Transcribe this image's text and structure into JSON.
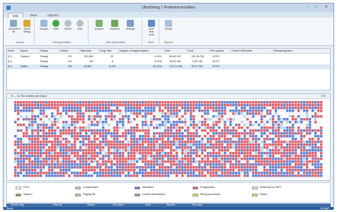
{
  "window": {
    "title": "UltraDefrag 7 Professional Edition",
    "minimize": "–",
    "maximize": "□",
    "close": "✕"
  },
  "ribbon_tabs": [
    {
      "label": "Disk",
      "active": true
    },
    {
      "label": "View",
      "active": false
    },
    {
      "label": "Options",
      "active": false
    }
  ],
  "ribbon_groups": [
    {
      "label": "Actions",
      "buttons": [
        {
          "label": "Autodetect all",
          "icon": "drive-icon",
          "color": "#8aa7c8"
        },
        {
          "label": "Quick defrag",
          "icon": "broom-icon",
          "color": "#d5a935"
        }
      ]
    },
    {
      "label": "Defragmentation",
      "buttons": [
        {
          "label": "Analyze",
          "icon": "magnify-icon",
          "color": "#9bb8d8"
        },
        {
          "label": "Start",
          "icon": "play-icon",
          "color": "#3fa845"
        },
        {
          "label": "Pause",
          "icon": "pause-icon",
          "color": "#b8c0c8"
        },
        {
          "label": "Stop",
          "icon": "stop-icon",
          "color": "#b8c0c8"
        }
      ]
    },
    {
      "label": "Disk Optimization",
      "buttons": [
        {
          "label": "Analyze",
          "icon": "chart-icon",
          "color": "#7bb26a"
        },
        {
          "label": "Optimize",
          "icon": "optimize-icon",
          "color": "#6fa75c"
        },
        {
          "label": "Settings",
          "icon": "settings-icon",
          "color": "#7b9bc8"
        }
      ]
    },
    {
      "label": "Boot",
      "buttons": [
        {
          "label": "Boot time scan",
          "icon": "boot-icon",
          "color": "#5d8cc4"
        }
      ]
    },
    {
      "label": "Reports",
      "buttons": [
        {
          "label": "Create",
          "icon": "report-icon",
          "color": "#a9c0da"
        }
      ]
    }
  ],
  "table": {
    "columns": [
      "Drive",
      "Name",
      "Status",
      "Status",
      "Total files",
      "Frag. files",
      "Degree of fragmentation",
      "Size",
      "Free",
      "File system",
      "Current file/folder",
      "Remaining time"
    ],
    "rows": [
      [
        "(C:)",
        "System",
        "Ready",
        "0%",
        "120,082",
        "20",
        "",
        "11.6%",
        "99.66 GB",
        "125.35 GB",
        "NTFS",
        "",
        ""
      ],
      [
        "(D:)",
        "",
        "Ready",
        "0%",
        "100",
        "0",
        "",
        "0.00%",
        "78.69 GB",
        "0.62 GB",
        "NTFS",
        "",
        ""
      ],
      [
        "(E:)",
        "Daten",
        "Ready",
        "0%",
        "10,567",
        "8,423",
        "",
        "40.32%",
        "173.73 GB",
        "76.47 GB",
        "NTFS",
        "",
        ""
      ]
    ],
    "selected_row": 2
  },
  "map": {
    "title": "E: – 11,784 clusters per block",
    "progress": "0 %"
  },
  "legend": [
    {
      "label": "Free",
      "color": "#ffffff"
    },
    {
      "label": "Compressed",
      "color": "#c6c6c6"
    },
    {
      "label": "Allocated",
      "color": "#5b7fd4"
    },
    {
      "label": "Fragmented",
      "color": "#e35b65"
    },
    {
      "label": "Reserved for MFT",
      "color": "#f2e0c8"
    },
    {
      "label": "System",
      "color": "#7c9a4c"
    },
    {
      "label": "Paging file",
      "color": "#a8d58e"
    },
    {
      "label": "Locked files/folders",
      "color": "#8f9bb0"
    },
    {
      "label": "Being processed",
      "color": "#f5d23c"
    },
    {
      "label": "Folder",
      "color": "#f2d178"
    }
  ],
  "bottom_tabs": [
    "Cluster Map",
    "Files list",
    "History",
    "File status",
    "Stats",
    "Reports",
    "File maps"
  ],
  "status": {
    "left": "Ready",
    "right": "Defrag®"
  }
}
